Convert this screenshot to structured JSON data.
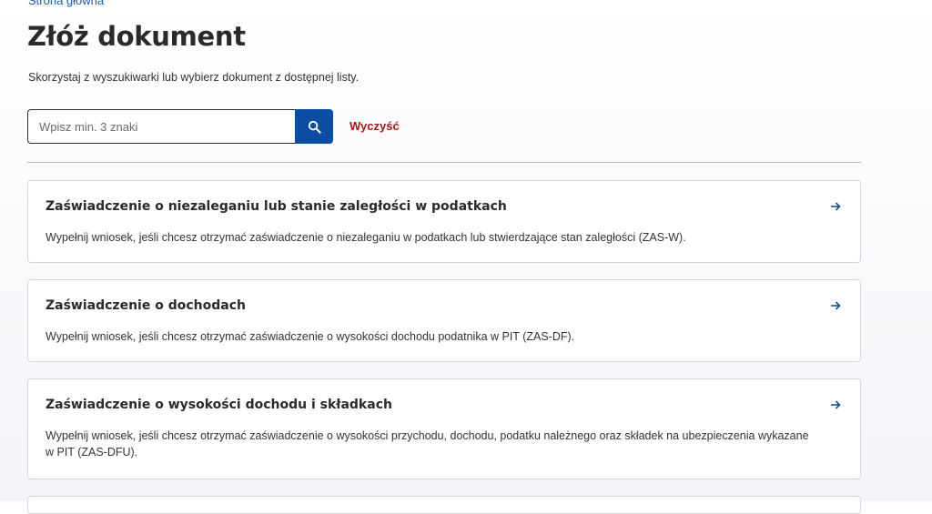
{
  "breadcrumb": {
    "label": "Strona główna"
  },
  "page": {
    "title": "Złóż dokument",
    "intro": "Skorzystaj z wyszukiwarki lub wybierz dokument z dostępnej listy."
  },
  "search": {
    "placeholder": "Wpisz min. 3 znaki",
    "value": "",
    "button_icon": "search-icon",
    "clear_label": "Wyczyść"
  },
  "colors": {
    "accent": "#0a4da2",
    "clear": "#a01b1b",
    "link": "#1e5aa8"
  },
  "documents": [
    {
      "title": "Zaświadczenie o niezaleganiu lub stanie zaległości w podatkach",
      "description": "Wypełnij wniosek, jeśli chcesz otrzymać zaświadczenie o niezaleganiu w podatkach lub stwierdzające stan zaległości (ZAS-W).",
      "icon": "arrow-right-icon"
    },
    {
      "title": "Zaświadczenie o dochodach",
      "description": "Wypełnij wniosek, jeśli chcesz otrzymać zaświadczenie o wysokości dochodu podatnika w PIT (ZAS-DF).",
      "icon": "arrow-right-icon"
    },
    {
      "title": "Zaświadczenie o wysokości dochodu i składkach",
      "description": "Wypełnij wniosek, jeśli chcesz otrzymać zaświadczenie o wysokości przychodu, dochodu, podatku należnego oraz składek na ubezpieczenia wykazane w PIT (ZAS-DFU).",
      "icon": "arrow-right-icon"
    }
  ]
}
